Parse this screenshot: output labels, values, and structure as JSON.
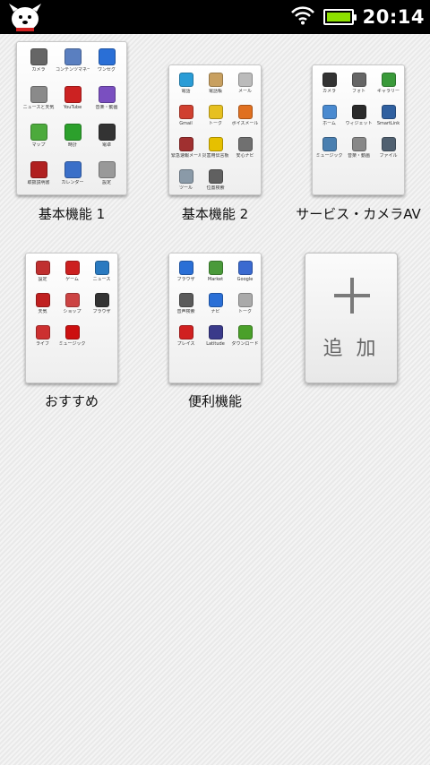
{
  "status_bar": {
    "time": "20:14",
    "icons": [
      "mascot-dog-icon",
      "wifi-icon",
      "battery-icon"
    ],
    "battery_level": 1.0,
    "battery_color": "#8de000"
  },
  "folders": [
    {
      "label": "基本機能 1",
      "apps": [
        {
          "label": "カメラ",
          "color": "#666666"
        },
        {
          "label": "コンテンツマネージャ",
          "color": "#5a7fc0"
        },
        {
          "label": "ワンセグ",
          "color": "#2a6fd6"
        },
        {
          "label": "ニュースと天気",
          "color": "#8a8a8a"
        },
        {
          "label": "YouTube",
          "color": "#cc2222"
        },
        {
          "label": "音楽・動画",
          "color": "#7a4fc0"
        },
        {
          "label": "マップ",
          "color": "#4caa3c"
        },
        {
          "label": "時計",
          "color": "#2ca02c"
        },
        {
          "label": "電卓",
          "color": "#333333"
        },
        {
          "label": "取扱説明書",
          "color": "#b02020"
        },
        {
          "label": "カレンダー",
          "color": "#3a6fc8"
        },
        {
          "label": "設定",
          "color": "#999999"
        }
      ]
    },
    {
      "label": "基本機能 2",
      "apps": [
        {
          "label": "電話",
          "color": "#2a9cd6"
        },
        {
          "label": "電話帳",
          "color": "#c8a060"
        },
        {
          "label": "メール",
          "color": "#bbbbbb"
        },
        {
          "label": "Gmail",
          "color": "#d04030"
        },
        {
          "label": "トーク",
          "color": "#e6c020"
        },
        {
          "label": "ボイスメール",
          "color": "#e07020"
        },
        {
          "label": "緊急速報メール",
          "color": "#a03030"
        },
        {
          "label": "災害用伝言板",
          "color": "#e6c000"
        },
        {
          "label": "安心ナビ",
          "color": "#707070"
        },
        {
          "label": "ツール",
          "color": "#8a9aa8"
        },
        {
          "label": "位置検索",
          "color": "#606060"
        }
      ]
    },
    {
      "label": "サービス・カメラAV",
      "apps": [
        {
          "label": "カメラ",
          "color": "#333333"
        },
        {
          "label": "フォト",
          "color": "#666666"
        },
        {
          "label": "ギャラリー",
          "color": "#3a9a3a"
        },
        {
          "label": "ホーム",
          "color": "#4a8ad0"
        },
        {
          "label": "ウィジェット",
          "color": "#2a2a2a"
        },
        {
          "label": "SmartLink",
          "color": "#3060a0"
        },
        {
          "label": "ミュージック",
          "color": "#4a7fb0"
        },
        {
          "label": "音楽・動画",
          "color": "#888888"
        },
        {
          "label": "ファイル",
          "color": "#506070"
        }
      ]
    },
    {
      "label": "おすすめ",
      "apps": [
        {
          "label": "設定",
          "color": "#c03030"
        },
        {
          "label": "ゲーム",
          "color": "#cc2020"
        },
        {
          "label": "ニュース",
          "color": "#2a7ac0"
        },
        {
          "label": "天気",
          "color": "#c02020"
        },
        {
          "label": "ショップ",
          "color": "#cc4444"
        },
        {
          "label": "ブラウザ",
          "color": "#333333"
        },
        {
          "label": "ライフ",
          "color": "#cc3030"
        },
        {
          "label": "ミュージック",
          "color": "#cc1010"
        }
      ]
    },
    {
      "label": "便利機能",
      "apps": [
        {
          "label": "ブラウザ",
          "color": "#2a6fd6"
        },
        {
          "label": "Market",
          "color": "#4a9a3a"
        },
        {
          "label": "Google",
          "color": "#3a6ad0"
        },
        {
          "label": "音声検索",
          "color": "#5a5a5a"
        },
        {
          "label": "ナビ",
          "color": "#2a6fd6"
        },
        {
          "label": "トーク",
          "color": "#aaaaaa"
        },
        {
          "label": "プレイス",
          "color": "#d02020"
        },
        {
          "label": "Latitude",
          "color": "#3a3a8a"
        },
        {
          "label": "ダウンロード",
          "color": "#4aa02a"
        }
      ]
    }
  ],
  "add_tile": {
    "label": "追 加",
    "icon": "plus-icon"
  }
}
